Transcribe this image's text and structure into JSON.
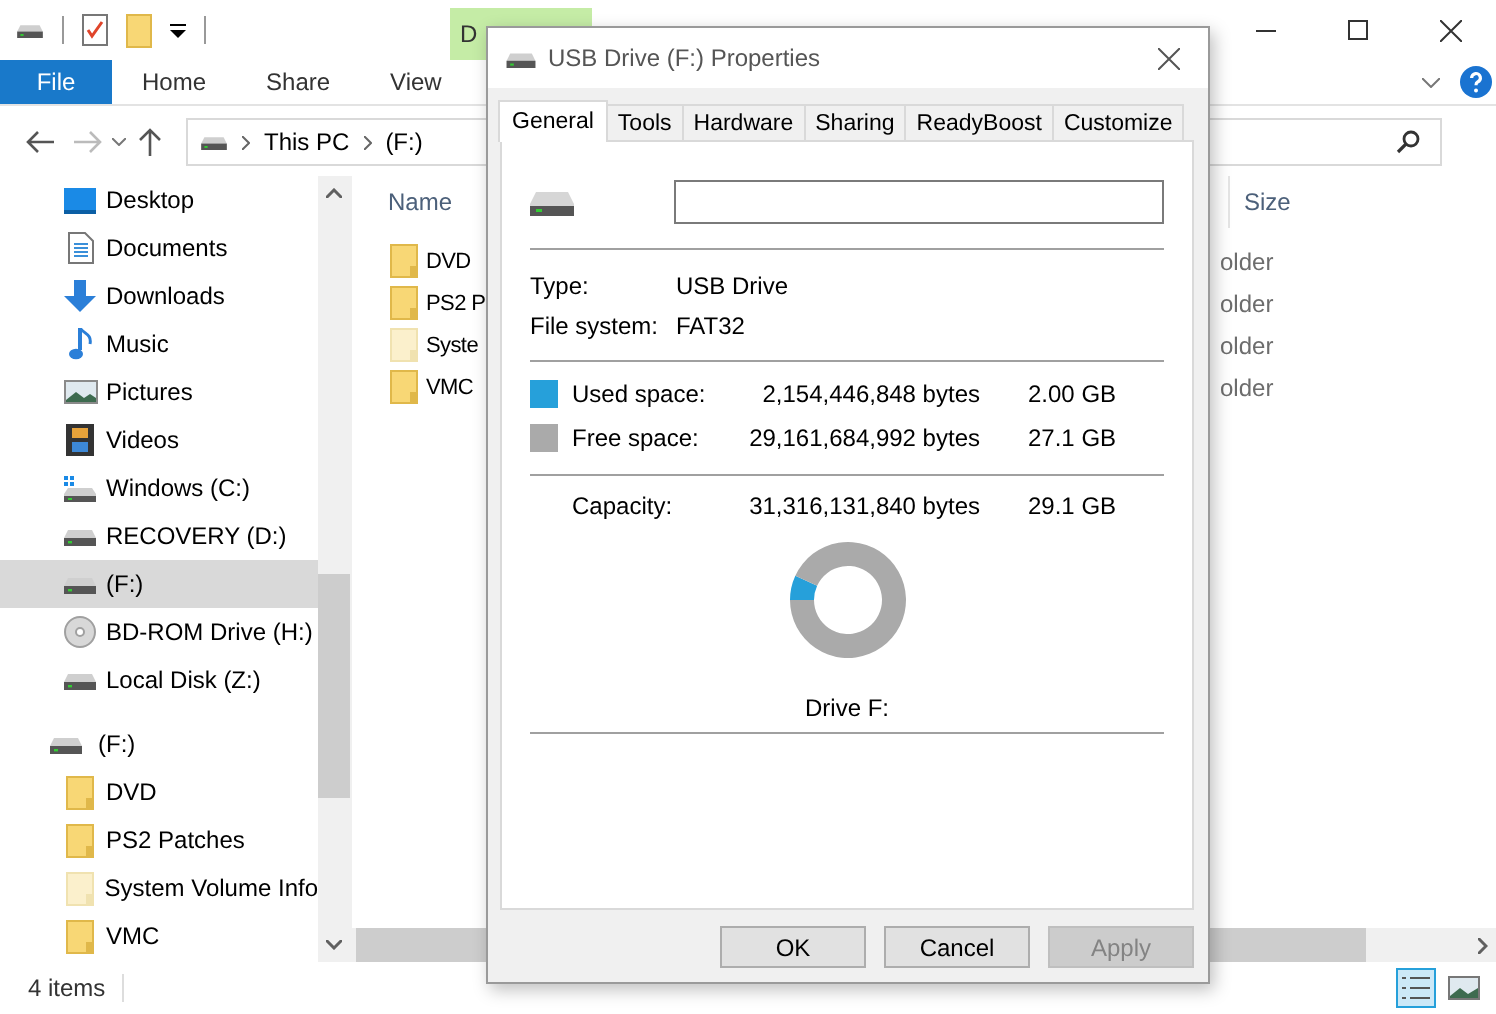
{
  "explorer": {
    "title_bar": {
      "contextual_tab": "D"
    },
    "ribbon_tabs": [
      {
        "label": "File",
        "kind": "file"
      },
      {
        "label": "Home",
        "kind": "tab"
      },
      {
        "label": "Share",
        "kind": "tab"
      },
      {
        "label": "View",
        "kind": "tab"
      }
    ],
    "address": {
      "path": [
        "This PC",
        "(F:)"
      ]
    },
    "navigation": {
      "items": [
        {
          "label": "Desktop",
          "kind": "desktop",
          "selected": false
        },
        {
          "label": "Documents",
          "kind": "documents",
          "selected": false
        },
        {
          "label": "Downloads",
          "kind": "downloads",
          "selected": false
        },
        {
          "label": "Music",
          "kind": "music",
          "selected": false
        },
        {
          "label": "Pictures",
          "kind": "pictures",
          "selected": false
        },
        {
          "label": "Videos",
          "kind": "videos",
          "selected": false
        },
        {
          "label": "Windows (C:)",
          "kind": "windows-drive",
          "selected": false
        },
        {
          "label": "RECOVERY (D:)",
          "kind": "drive",
          "selected": false
        },
        {
          "label": "(F:)",
          "kind": "drive",
          "selected": true
        },
        {
          "label": "BD-ROM Drive (H:)",
          "kind": "optical",
          "selected": false
        },
        {
          "label": "Local Disk (Z:)",
          "kind": "drive",
          "selected": false
        }
      ],
      "tree": {
        "label": "(F:)",
        "children": [
          {
            "label": "DVD",
            "hidden": false
          },
          {
            "label": "PS2 Patches",
            "hidden": false
          },
          {
            "label": "System Volume Info",
            "hidden": true
          },
          {
            "label": "VMC",
            "hidden": false
          }
        ]
      }
    },
    "file_list": {
      "columns": [
        "Name",
        "Size"
      ],
      "rows": [
        {
          "name": "DVD",
          "type": "older",
          "hidden": false
        },
        {
          "name": "PS2 P",
          "type": "older",
          "hidden": false
        },
        {
          "name": "Syste",
          "type": "older",
          "hidden": true
        },
        {
          "name": "VMC",
          "type": "older",
          "hidden": false
        }
      ]
    },
    "status_bar": {
      "item_count": "4 items",
      "views": [
        {
          "kind": "details",
          "selected": true
        },
        {
          "kind": "large-icons",
          "selected": false
        }
      ]
    }
  },
  "dialog": {
    "title": "USB Drive (F:) Properties",
    "tabs": [
      {
        "label": "General",
        "selected": true
      },
      {
        "label": "Tools",
        "selected": false
      },
      {
        "label": "Hardware",
        "selected": false
      },
      {
        "label": "Sharing",
        "selected": false
      },
      {
        "label": "ReadyBoost",
        "selected": false
      },
      {
        "label": "Customize",
        "selected": false
      }
    ],
    "info": [
      {
        "label": "Type:",
        "value": "USB Drive"
      },
      {
        "label": "File system:",
        "value": "FAT32"
      }
    ],
    "space": [
      {
        "label": "Used space:",
        "bytes": "2,154,446,848 bytes",
        "size": "2.00 GB",
        "color": "#26a0da"
      },
      {
        "label": "Free space:",
        "bytes": "29,161,684,992 bytes",
        "size": "27.1 GB",
        "color": "#aaaaaa"
      }
    ],
    "capacity": {
      "label": "Capacity:",
      "bytes": "31,316,131,840 bytes",
      "size": "29.1 GB"
    },
    "chart_data": {
      "type": "donut",
      "values": [
        6.88,
        93.12
      ]
    },
    "drive_label": "Drive F:",
    "buttons": [
      {
        "label": "OK",
        "disabled": false
      },
      {
        "label": "Cancel",
        "disabled": false
      },
      {
        "label": "Apply",
        "disabled": true
      }
    ]
  }
}
